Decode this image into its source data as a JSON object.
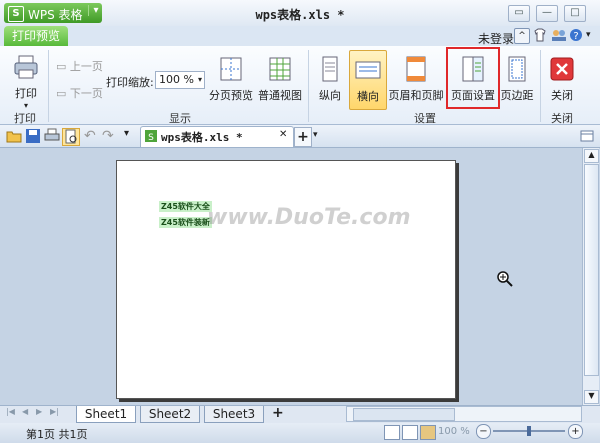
{
  "app": {
    "name": "WPS 表格",
    "logo_letter": "S",
    "dropdown_arrow": "▾"
  },
  "window": {
    "title": "wps表格.xls *",
    "controls": {
      "restore": "▭",
      "minimize": "—",
      "maximize": "□",
      "close": "✕"
    }
  },
  "ribbon_tabs": {
    "print_preview": "打印预览"
  },
  "account": {
    "login": "未登录"
  },
  "ribbon": {
    "print": {
      "label": "打印",
      "arrow": "▾"
    },
    "prev_page": "上一页",
    "next_page": "下一页",
    "zoom": {
      "label": "打印缩放:",
      "value": "100 %"
    },
    "page_break_preview": "分页预览",
    "normal_view": "普通视图",
    "portrait": "纵向",
    "landscape": "横向",
    "header_footer": "页眉和页脚",
    "page_setup": "页面设置",
    "margins": "页边距",
    "close": "关闭",
    "groups": {
      "print": "打印",
      "display": "显示",
      "settings": "设置",
      "close": "关闭"
    }
  },
  "quickbar": {
    "undo": "↶",
    "redo": "↷",
    "more": "▾"
  },
  "doc_tab": {
    "label": "wps表格.xls *",
    "close": "✕",
    "add": "+",
    "add_arrow": "▾"
  },
  "preview": {
    "cells": [
      "Z45软件大全",
      "Z45软件装新"
    ],
    "watermark": "www.DuoTe.com"
  },
  "sheets": {
    "nav": [
      "|◀",
      "◀",
      "▶",
      "▶|"
    ],
    "tabs": [
      "Sheet1",
      "Sheet2",
      "Sheet3"
    ],
    "add": "+",
    "active_index": 0
  },
  "status": {
    "page_info": "第1页 共1页",
    "zoom": "100 %",
    "minus": "−",
    "plus": "+"
  },
  "colors": {
    "highlight_box": "#e0282a",
    "app_green": "#3f9a26",
    "page_bg": "#ffffff",
    "workspace_bg": "#c5d3e4"
  }
}
